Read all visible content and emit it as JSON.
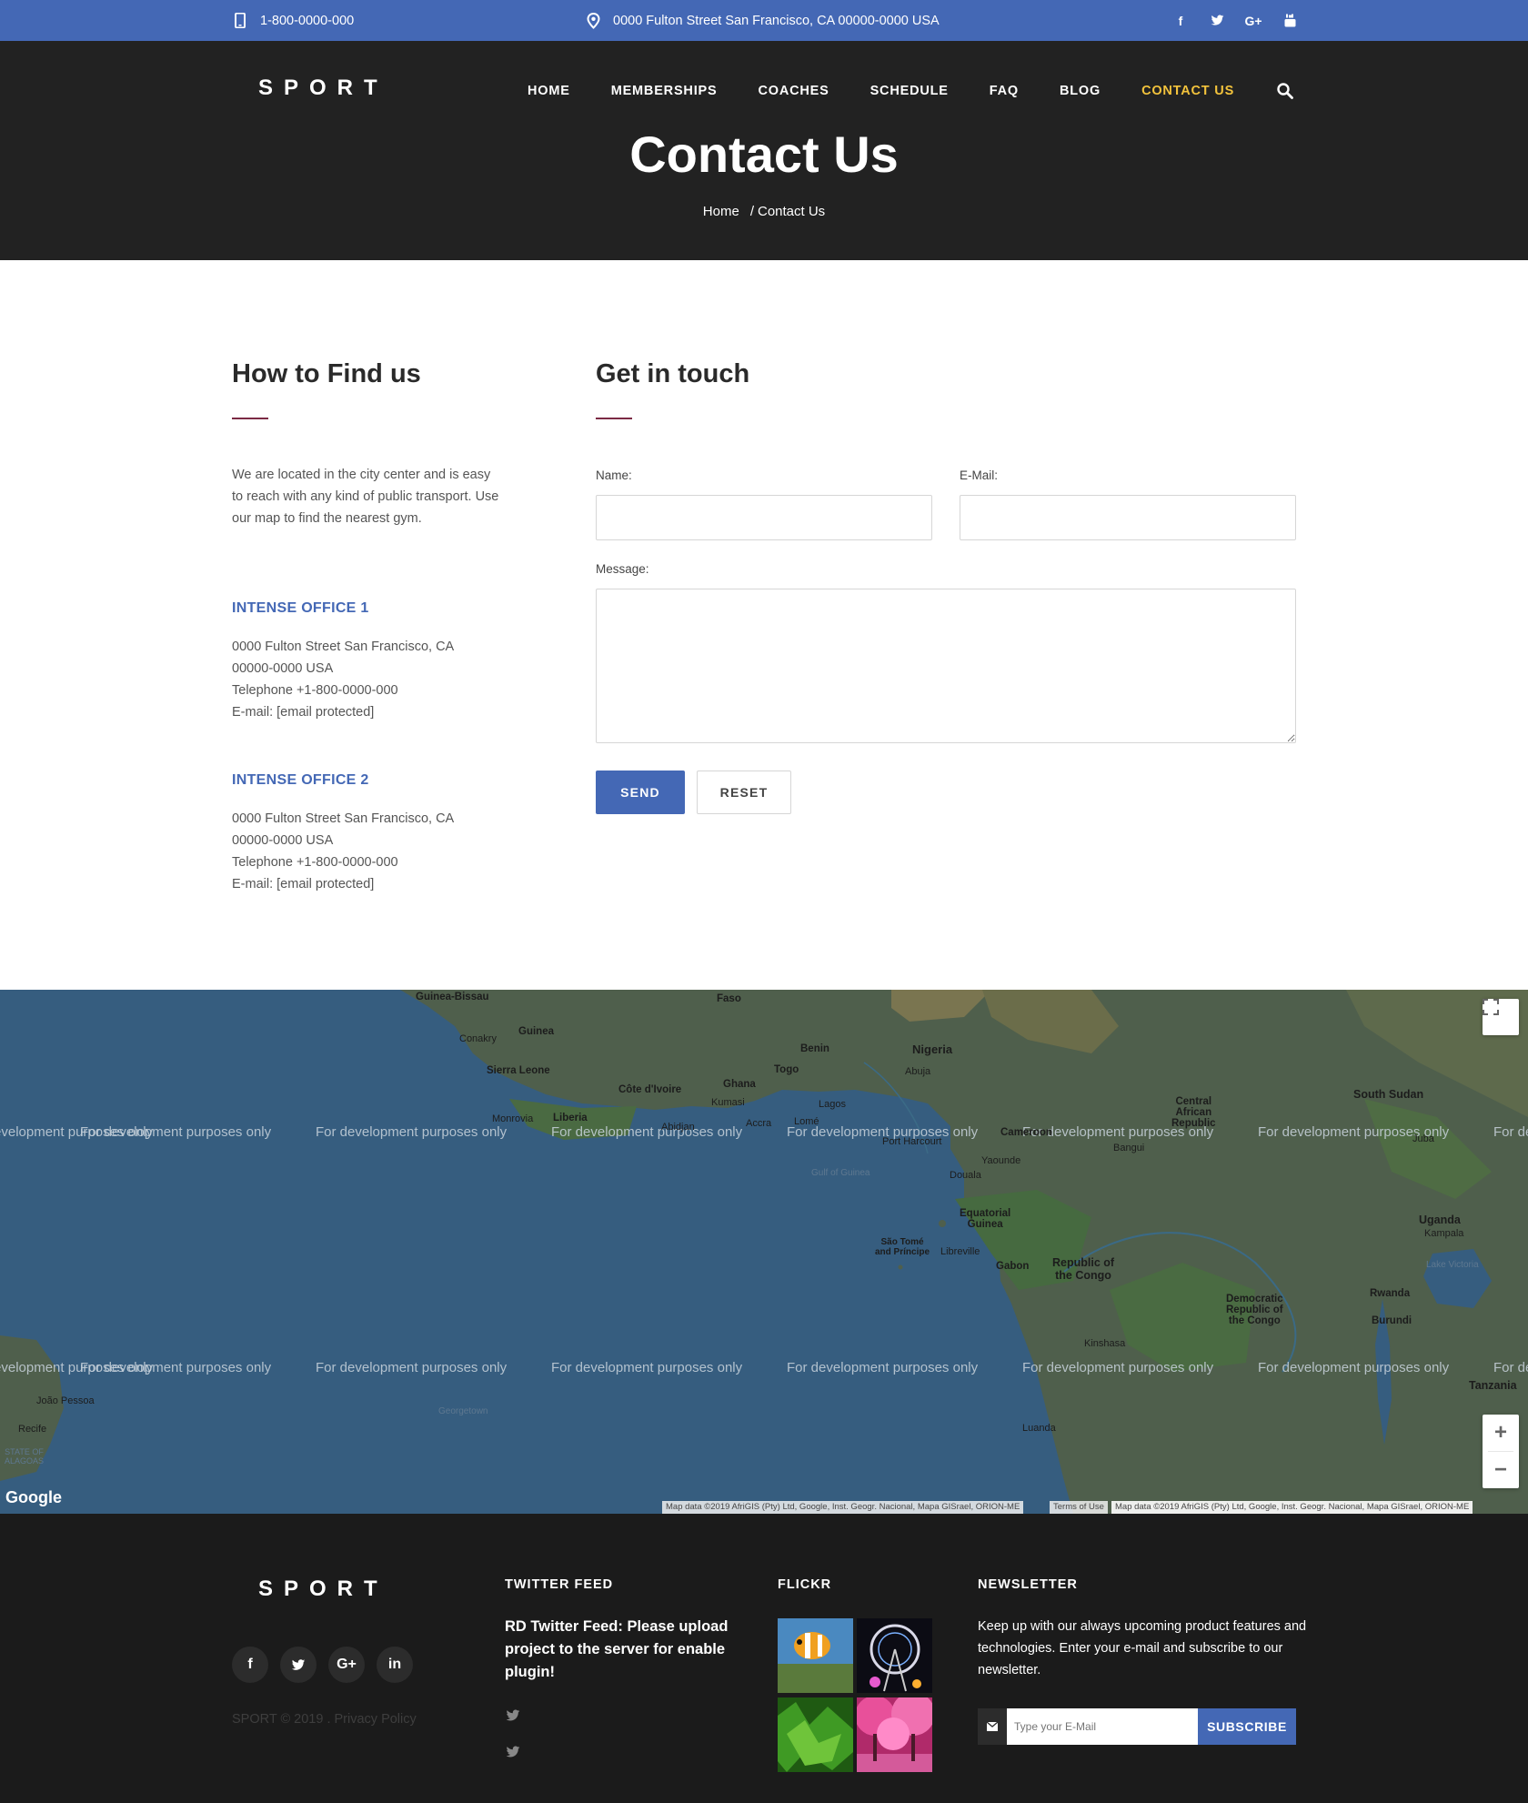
{
  "topbar": {
    "phone": "1-800-0000-000",
    "address": "0000 Fulton Street San Francisco, CA 00000-0000 USA",
    "social": [
      "f",
      "t",
      "G+",
      "yt"
    ],
    "bg_color": "#4468b5"
  },
  "header": {
    "logo": "SPORT",
    "nav": [
      "HOME",
      "MEMBERSHIPS",
      "COACHES",
      "SCHEDULE",
      "FAQ",
      "BLOG",
      "CONTACT US"
    ],
    "active_nav": "CONTACT US",
    "active_color": "#f3c33c",
    "page_title": "Contact Us",
    "breadcrumb": {
      "home": "Home",
      "separator": "/",
      "current": "Contact Us"
    }
  },
  "find_us": {
    "title": "How to Find us",
    "description": "We are located in the city center and is easy to reach with any kind of public transport. Use our map to find the nearest gym.",
    "offices": [
      {
        "title": "INTENSE OFFICE 1",
        "address_line1": "0000 Fulton Street San Francisco, CA",
        "address_line2": "00000-0000 USA",
        "telephone": "Telephone +1-800-0000-000",
        "email": "E-mail: [email protected]"
      },
      {
        "title": "INTENSE OFFICE 2",
        "address_line1": "0000 Fulton Street San Francisco, CA",
        "address_line2": "00000-0000 USA",
        "telephone": "Telephone +1-800-0000-000",
        "email": "E-mail: [email protected]"
      }
    ]
  },
  "contact_form": {
    "title": "Get in touch",
    "name_label": "Name:",
    "name_value": "",
    "email_label": "E-Mail:",
    "email_value": "",
    "message_label": "Message:",
    "message_value": "",
    "send_label": "SEND",
    "reset_label": "RESET"
  },
  "map": {
    "watermark": "For development purposes only",
    "labels": {
      "guinea_bissau": "Guinea-Bissau",
      "faso": "Faso",
      "conakry": "Conakry",
      "guinea": "Guinea",
      "sierra_leone": "Sierra Leone",
      "cote_divoire": "Côte d'Ivoire",
      "ghana": "Ghana",
      "kumasi": "Kumasi",
      "togo": "Togo",
      "benin": "Benin",
      "nigeria": "Nigeria",
      "abuja": "Abuja",
      "lagos": "Lagos",
      "monrovia": "Monrovia",
      "liberia": "Liberia",
      "abidjan": "Abidjan",
      "accra": "Accra",
      "lome": "Lomé",
      "port_harcourt": "Port Harcourt",
      "cameroon": "Cameroon",
      "yaounde": "Yaounde",
      "douala": "Douala",
      "gulf": "Gulf of Guinea",
      "car1": "Central",
      "car2": "African",
      "car3": "Republic",
      "bangui": "Bangui",
      "south_sudan": "South Sudan",
      "juba": "Juba",
      "eq_guinea1": "Equatorial",
      "eq_guinea2": "Guinea",
      "sao_tome1": "São Tomé",
      "sao_tome2": "and Príncipe",
      "libreville": "Libreville",
      "gabon": "Gabon",
      "congo1": "Republic of",
      "congo2": "the Congo",
      "uganda": "Uganda",
      "kampala": "Kampala",
      "lake_victoria": "Lake Victoria",
      "drc1": "Democratic",
      "drc2": "Republic of",
      "drc3": "the Congo",
      "rwanda": "Rwanda",
      "burundi": "Burundi",
      "kinshasa": "Kinshasa",
      "tanzania": "Tanzania",
      "luanda": "Luanda",
      "joao_pessoa": "João Pessoa",
      "recife": "Recife",
      "alagoas1": "STATE OF",
      "alagoas2": "ALAGOAS",
      "georgetown": "Georgetown"
    },
    "google": "Google",
    "attribution": "Map data ©2019 AfriGIS (Pty) Ltd, Google, Inst. Geogr. Nacional, Mapa GISrael, ORION-ME",
    "terms": "Terms of Use",
    "zoom_in": "+",
    "zoom_out": "−"
  },
  "footer": {
    "logo": "SPORT",
    "social": [
      "f",
      "t",
      "G+",
      "in"
    ],
    "copyright": "SPORT © 2019 . Privacy Policy",
    "twitter_title": "TWITTER FEED",
    "twitter_text": "RD Twitter Feed: Please upload project to the server for enable plugin!",
    "flickr_title": "FLICKR",
    "newsletter_title": "NEWSLETTER",
    "newsletter_text": "Keep up with our always upcoming product features and technologies. Enter your e-mail and subscribe to our newsletter.",
    "newsletter_placeholder": "Type your E-Mail",
    "subscribe_label": "SUBSCRIBE"
  }
}
